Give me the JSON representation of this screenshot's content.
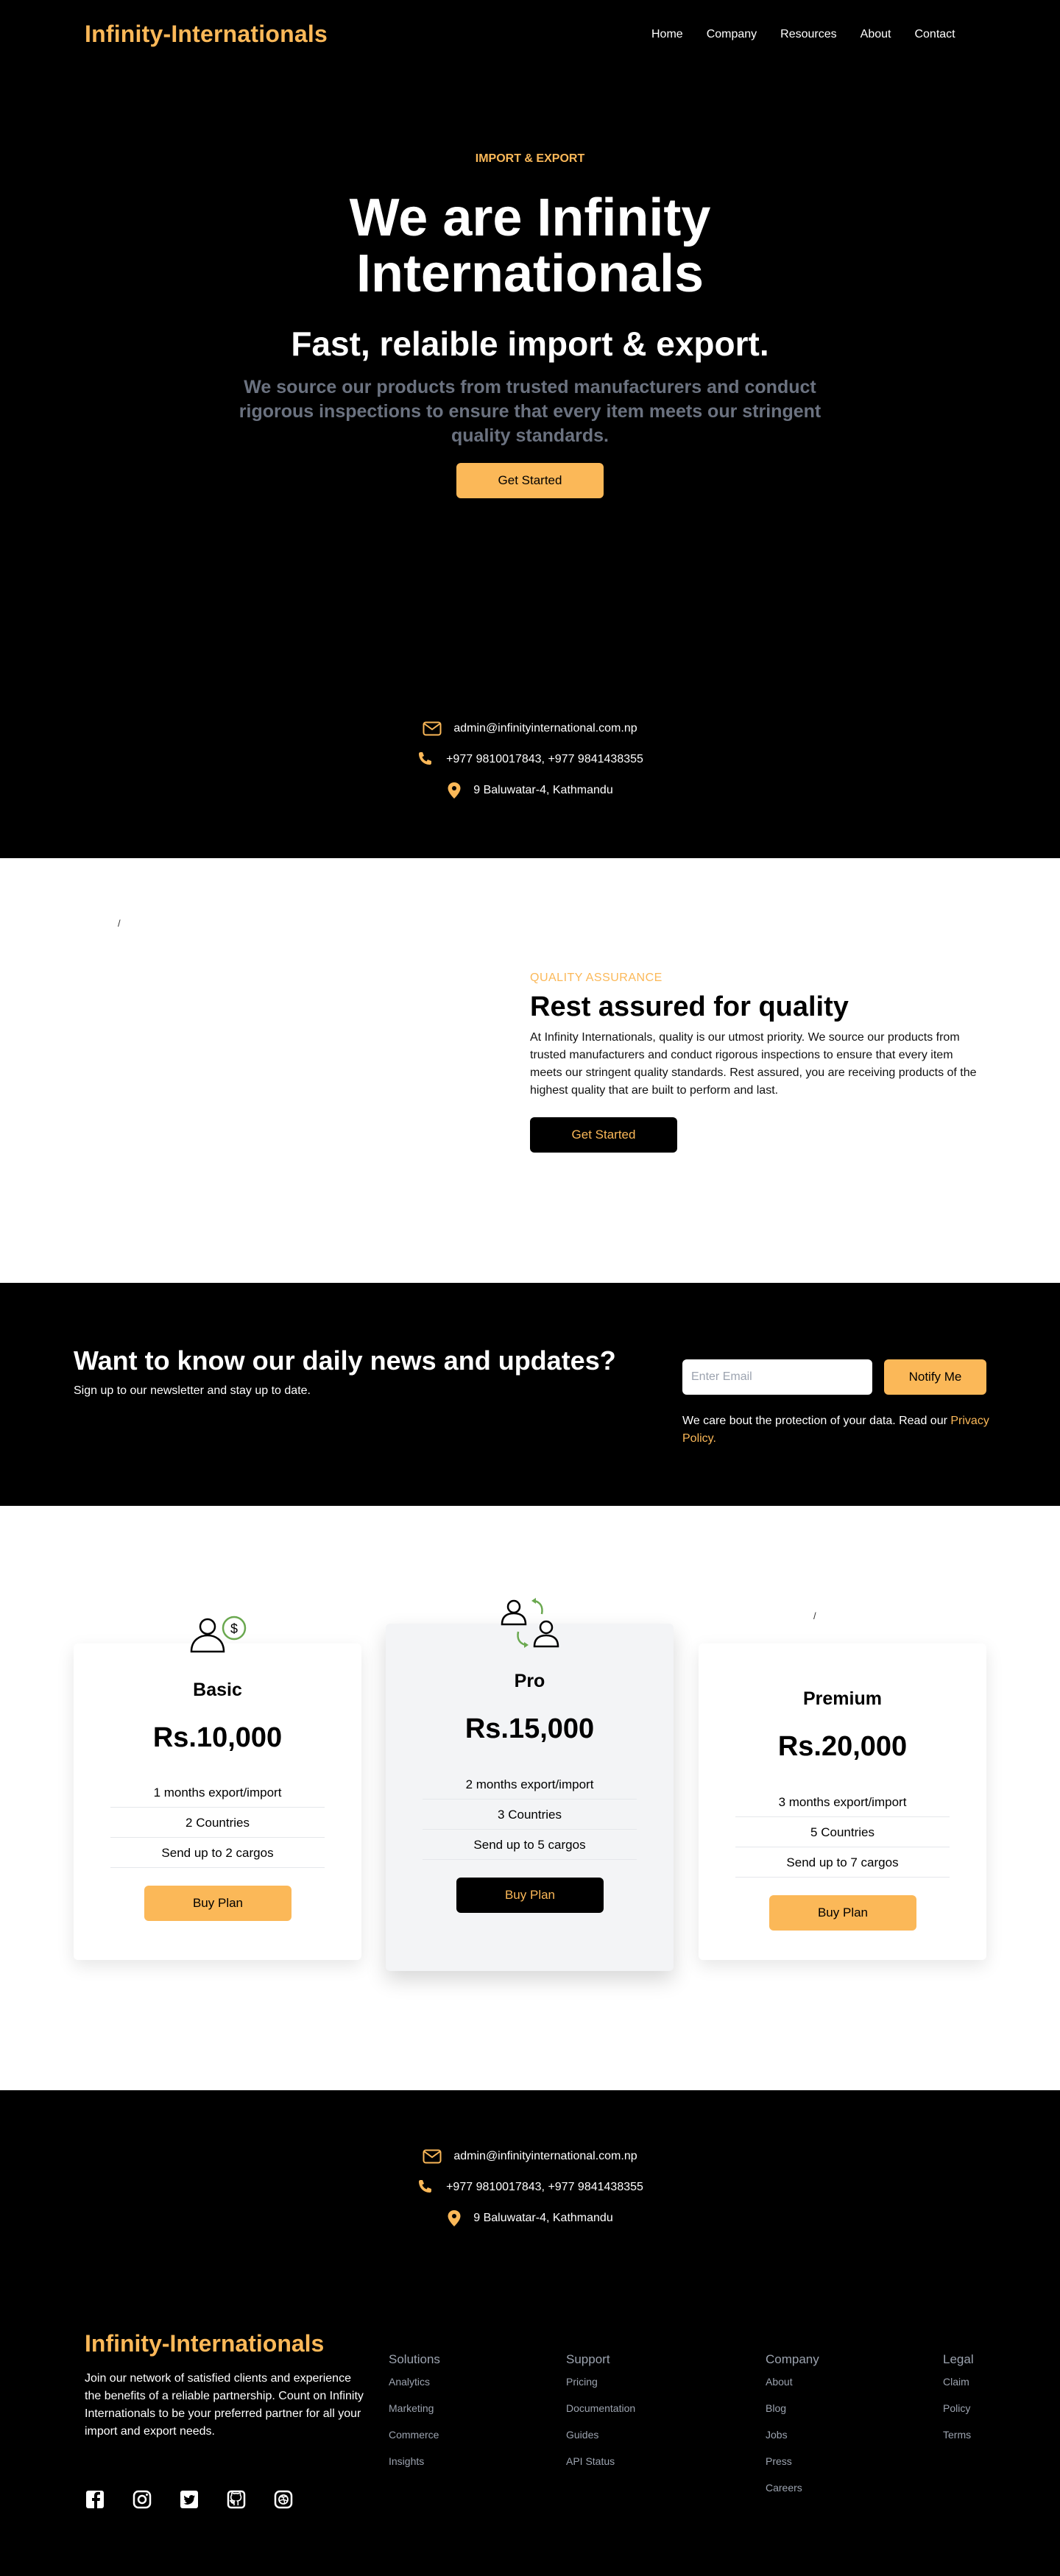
{
  "header": {
    "logo": "Infinity-Internationals",
    "nav": [
      "Home",
      "Company",
      "Resources",
      "About",
      "Contact"
    ]
  },
  "hero": {
    "eyebrow": "IMPORT & EXPORT",
    "title": "We are Infinity Internationals",
    "subtitle": "Fast, relaible import & export.",
    "description": "We source our products from trusted manufacturers and conduct rigorous inspections to ensure that every item meets our stringent quality standards.",
    "cta": "Get Started"
  },
  "contact": {
    "email": "admin@infinityinternational.com.np",
    "phone": "+977 9810017843, +977 9841438355",
    "address": "9 Baluwatar-4, Kathmandu"
  },
  "quality": {
    "image_alt": "/",
    "eyebrow": "QUALITY ASSURANCE",
    "title": "Rest assured for quality",
    "text": "At Infinity Internationals, quality is our utmost priority. We source our products from trusted manufacturers and conduct rigorous inspections to ensure that every item meets our stringent quality standards. Rest assured, you are receiving products of the highest quality that are built to perform and last.",
    "cta": "Get Started"
  },
  "newsletter": {
    "title": "Want to know our daily news and updates?",
    "subtitle": "Sign up to our newsletter and stay up to date.",
    "input_placeholder": "Enter Email",
    "button": "Notify Me",
    "note": "We care bout the protection of your data. Read our ",
    "privacy_link": "Privacy Policy."
  },
  "pricing": {
    "plans": [
      {
        "name": "Basic",
        "price": "Rs.10,000",
        "features": [
          "1 months export/import",
          "2 Countries",
          "Send up to 2 cargos"
        ],
        "button": "Buy Plan",
        "icon": "user-money-icon"
      },
      {
        "name": "Pro",
        "price": "Rs.15,000",
        "features": [
          "2 months export/import",
          "3 Countries",
          "Send up to 5 cargos"
        ],
        "button": "Buy Plan",
        "icon": "users-exchange-icon"
      },
      {
        "name": "Premium",
        "price": "Rs.20,000",
        "features": [
          "3 months export/import",
          "5 Countries",
          "Send up to 7 cargos"
        ],
        "button": "Buy Plan",
        "image_alt": "/"
      }
    ]
  },
  "footer": {
    "logo": "Infinity-Internationals",
    "about": "Join our network of satisfied clients and experience the benefits of a reliable partnership. Count on Infinity Internationals to be your preferred partner for all your import and export needs.",
    "social_icons": [
      "facebook-icon",
      "instagram-icon",
      "twitter-icon",
      "github-icon",
      "dribbble-icon"
    ],
    "columns": [
      {
        "title": "Solutions",
        "links": [
          "Analytics",
          "Marketing",
          "Commerce",
          "Insights"
        ]
      },
      {
        "title": "Support",
        "links": [
          "Pricing",
          "Documentation",
          "Guides",
          "API Status"
        ]
      },
      {
        "title": "Company",
        "links": [
          "About",
          "Blog",
          "Jobs",
          "Press",
          "Careers"
        ]
      },
      {
        "title": "Legal",
        "links": [
          "Claim",
          "Policy",
          "Terms"
        ]
      }
    ]
  },
  "colors": {
    "accent": "#fbb858",
    "dark": "#000000",
    "muted": "#6b7280",
    "card_alt": "#f3f4f6"
  }
}
